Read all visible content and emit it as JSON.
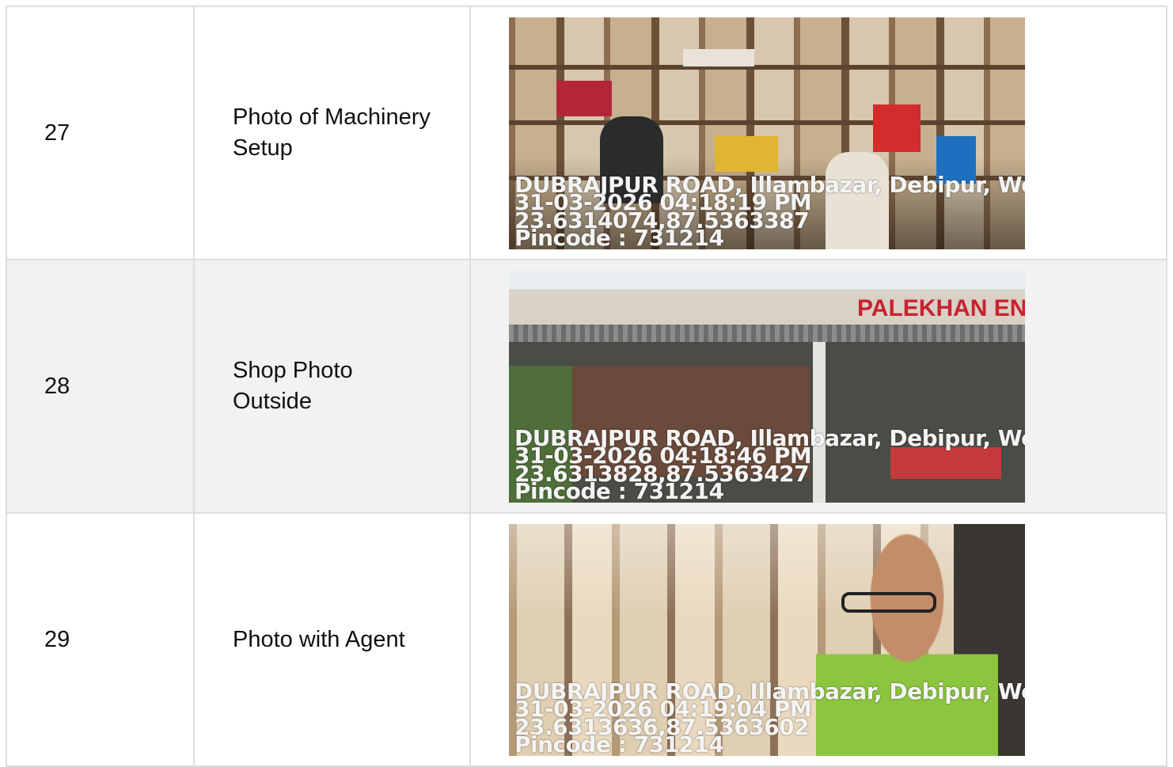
{
  "rows": [
    {
      "number": "27",
      "label_line1": "Photo of Machinery",
      "label_line2": "Setup",
      "stamp": {
        "address": "DUBRAJPUR ROAD, Illambazar, Debipur, We",
        "datetime": "31-03-2026 04:18:19 PM",
        "coords": "23.6314074,87.5363387",
        "pincode": "Pincode : 731214"
      }
    },
    {
      "number": "28",
      "label_line1": "Shop Photo",
      "label_line2": "Outside",
      "sign_text": "PALEKHAN ENT",
      "stamp": {
        "address": "DUBRAJPUR ROAD, Illambazar, Debipur, We",
        "datetime": "31-03-2026 04:18:46 PM",
        "coords": "23.6313828,87.5363427",
        "pincode": "Pincode : 731214"
      }
    },
    {
      "number": "29",
      "label_line1": "Photo with Agent",
      "label_line2": "",
      "stamp": {
        "address": "DUBRAJPUR ROAD, Illambazar, Debipur, We",
        "datetime": "31-03-2026 04:19:04 PM",
        "coords": "23.6313636,87.5363602",
        "pincode": "Pincode : 731214"
      }
    }
  ]
}
